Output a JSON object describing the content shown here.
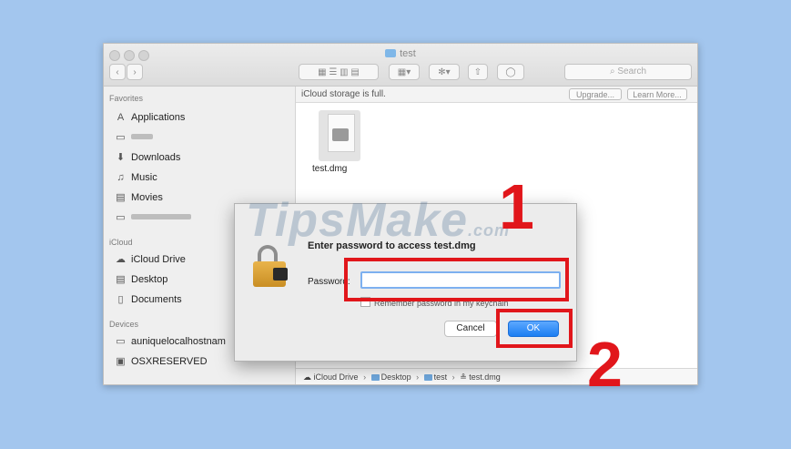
{
  "window": {
    "title": "test",
    "search_placeholder": "Search",
    "banner_text": "iCloud storage is full.",
    "upgrade_label": "Upgrade...",
    "learn_more_label": "Learn More..."
  },
  "sidebar": {
    "favorites_header": "Favorites",
    "favorites": [
      {
        "label": "Applications",
        "icon": "applications-icon"
      },
      {
        "label": "",
        "icon": "folder-icon"
      },
      {
        "label": "Downloads",
        "icon": "downloads-icon"
      },
      {
        "label": "Music",
        "icon": "music-icon"
      },
      {
        "label": "Movies",
        "icon": "movies-icon"
      },
      {
        "label": "",
        "icon": "folder-icon"
      }
    ],
    "icloud_header": "iCloud",
    "icloud": [
      {
        "label": "iCloud Drive",
        "icon": "cloud-icon"
      },
      {
        "label": "Desktop",
        "icon": "desktop-icon"
      },
      {
        "label": "Documents",
        "icon": "documents-icon"
      }
    ],
    "devices_header": "Devices",
    "devices": [
      {
        "label": "auniquelocalhostnam",
        "icon": "computer-icon"
      },
      {
        "label": "OSXRESERVED",
        "icon": "disk-icon"
      }
    ]
  },
  "content": {
    "file_name": "test.dmg"
  },
  "statusbar": {
    "path": [
      "iCloud Drive",
      "Desktop",
      "test",
      "test.dmg"
    ]
  },
  "dialog": {
    "title": "Enter password to access test.dmg",
    "password_label": "Password:",
    "password_value": "",
    "remember_label": "Remember password in my keychain",
    "cancel_label": "Cancel",
    "ok_label": "OK"
  },
  "annotations": {
    "step1": "1",
    "step2": "2"
  },
  "watermark": {
    "text": "TipsMake",
    "suffix": ".com"
  },
  "colors": {
    "background": "#a3c6ee",
    "annotation_red": "#e1161b",
    "ok_blue": "#1c7ef2"
  }
}
